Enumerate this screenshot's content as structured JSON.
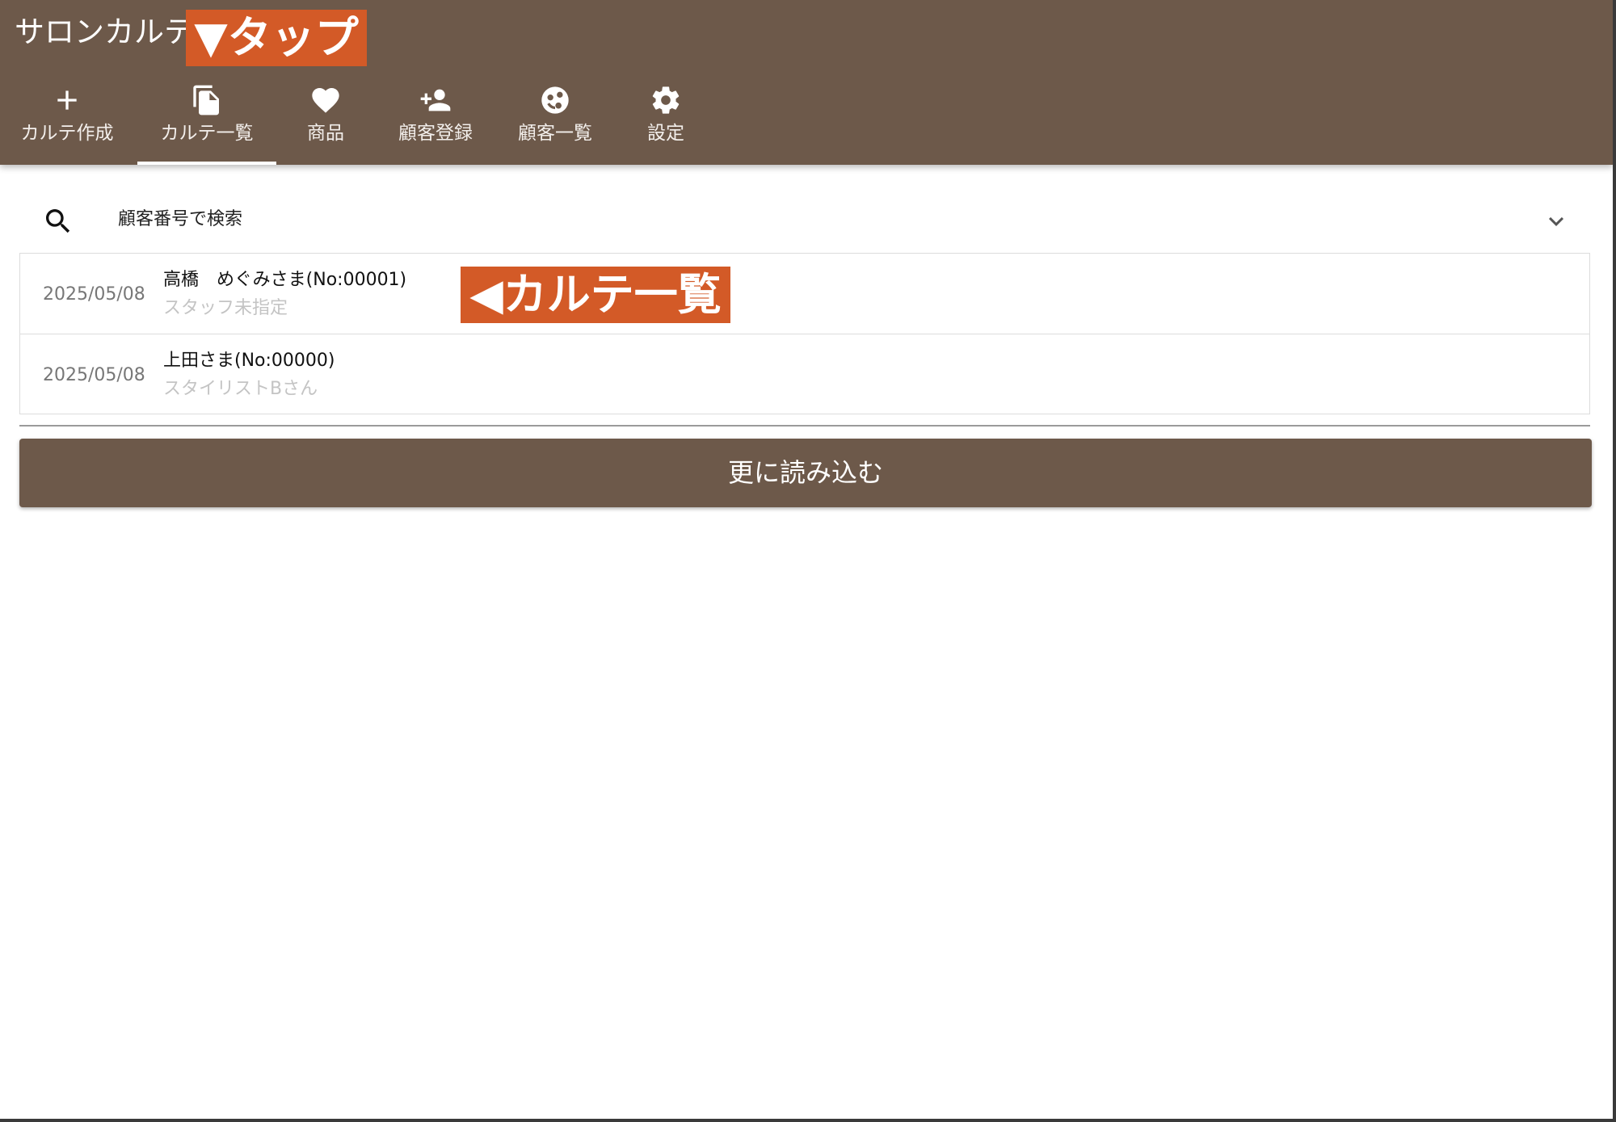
{
  "app": {
    "title": "サロンカルテ"
  },
  "annotations": {
    "tap_label": "▼タップ",
    "list_label": "◀カルテ一覧",
    "accent_color": "#d35a27"
  },
  "theme": {
    "primary_color": "#6d594a"
  },
  "nav": {
    "tabs": [
      {
        "label": "カルテ作成",
        "icon": "plus-icon",
        "active": false
      },
      {
        "label": "カルテ一覧",
        "icon": "copy-icon",
        "active": true
      },
      {
        "label": "商品",
        "icon": "heart-icon",
        "active": false
      },
      {
        "label": "顧客登録",
        "icon": "person-add-icon",
        "active": false
      },
      {
        "label": "顧客一覧",
        "icon": "face-icon",
        "active": false
      },
      {
        "label": "設定",
        "icon": "gear-icon",
        "active": false
      }
    ]
  },
  "search": {
    "label": "顧客番号で検索",
    "icon": "search-icon",
    "expand_icon": "chevron-down-icon"
  },
  "records": [
    {
      "date": "2025/05/08",
      "name": "高橋　めぐみさま(No:00001)",
      "staff": "スタッフ未指定"
    },
    {
      "date": "2025/05/08",
      "name": "上田さま(No:00000)",
      "staff": "スタイリストBさん"
    }
  ],
  "actions": {
    "load_more_label": "更に読み込む"
  }
}
